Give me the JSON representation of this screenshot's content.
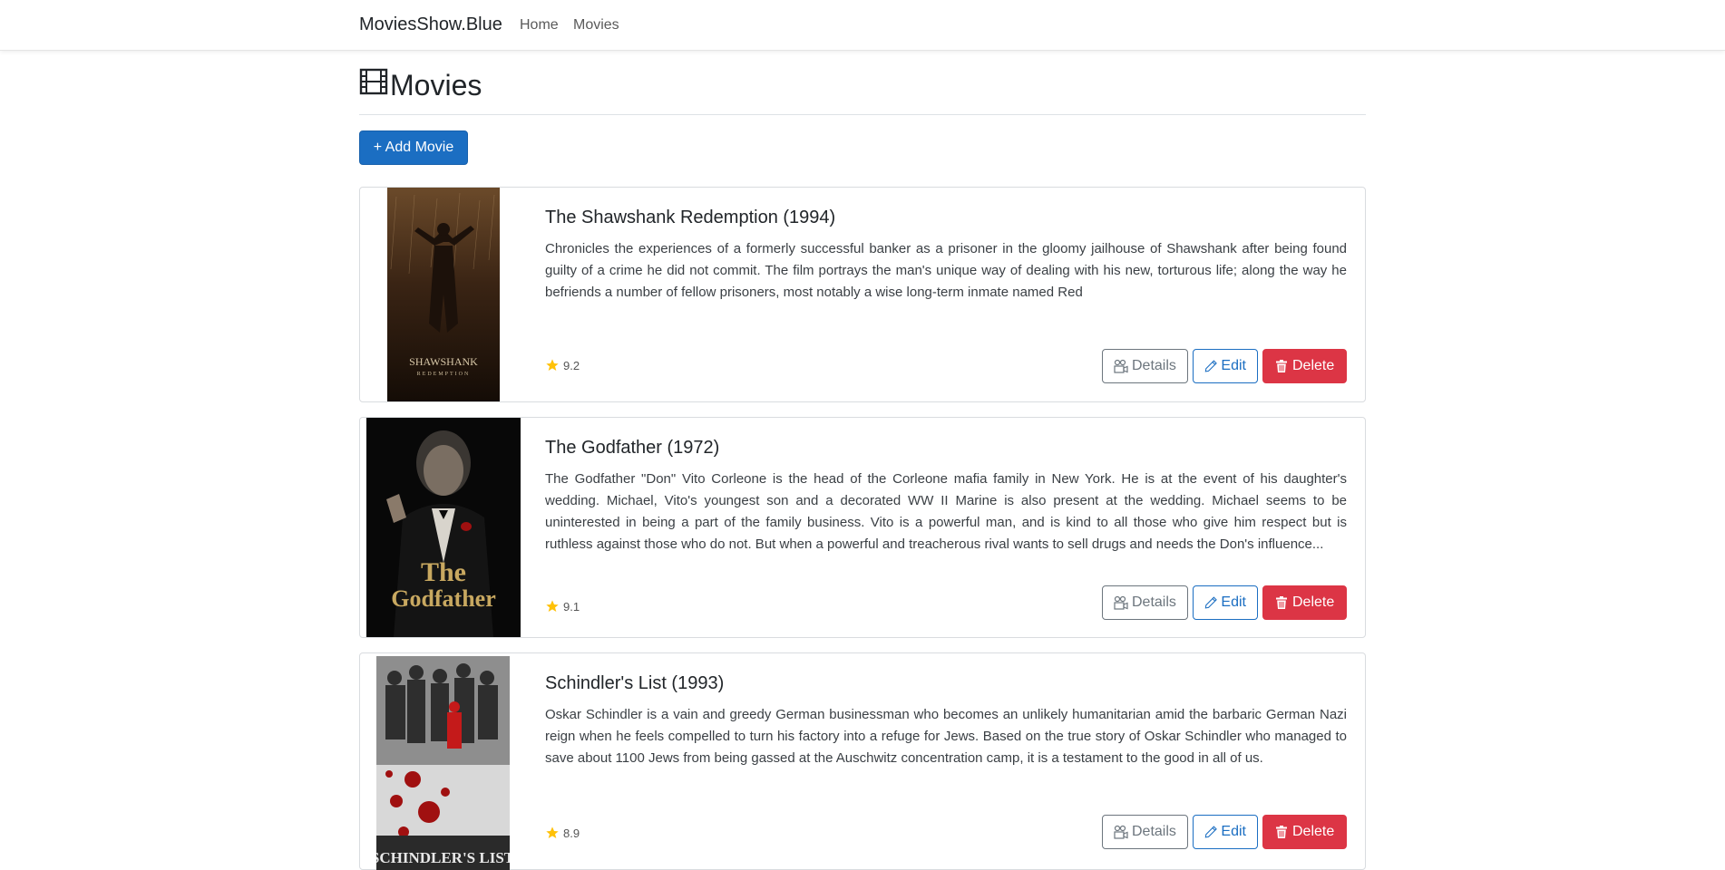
{
  "navbar": {
    "brand": "MoviesShow.Blue",
    "links": [
      "Home",
      "Movies"
    ]
  },
  "page": {
    "title": "Movies",
    "add_button": "+ Add Movie"
  },
  "buttons": {
    "details": "Details",
    "edit": "Edit",
    "delete": "Delete"
  },
  "movies": [
    {
      "title": "The Shawshank Redemption (1994)",
      "description": "Chronicles the experiences of a formerly successful banker as a prisoner in the gloomy jailhouse of Shawshank after being found guilty of a crime he did not commit. The film portrays the man's unique way of dealing with his new, torturous life; along the way he befriends a number of fellow prisoners, most notably a wise long-term inmate named Red",
      "rating": "9.2",
      "poster_text": "SHAWSHANK",
      "poster_subtext": "REDEMPTION"
    },
    {
      "title": "The Godfather (1972)",
      "description": "The Godfather \"Don\" Vito Corleone is the head of the Corleone mafia family in New York. He is at the event of his daughter's wedding. Michael, Vito's youngest son and a decorated WW II Marine is also present at the wedding. Michael seems to be uninterested in being a part of the family business. Vito is a powerful man, and is kind to all those who give him respect but is ruthless against those who do not. But when a powerful and treacherous rival wants to sell drugs and needs the Don's influence...",
      "rating": "9.1",
      "poster_text": "The",
      "poster_subtext": "Godfather"
    },
    {
      "title": "Schindler's List (1993)",
      "description": "Oskar Schindler is a vain and greedy German businessman who becomes an unlikely humanitarian amid the barbaric German Nazi reign when he feels compelled to turn his factory into a refuge for Jews. Based on the true story of Oskar Schindler who managed to save about 1100 Jews from being gassed at the Auschwitz concentration camp, it is a testament to the good in all of us.",
      "rating": "8.9",
      "poster_text": "SCHINDLER'S LIST",
      "poster_subtext": ""
    }
  ],
  "colors": {
    "primary": "#1b6ec2",
    "danger": "#dc3545",
    "secondary": "#6c757d",
    "star": "#ffc107"
  }
}
